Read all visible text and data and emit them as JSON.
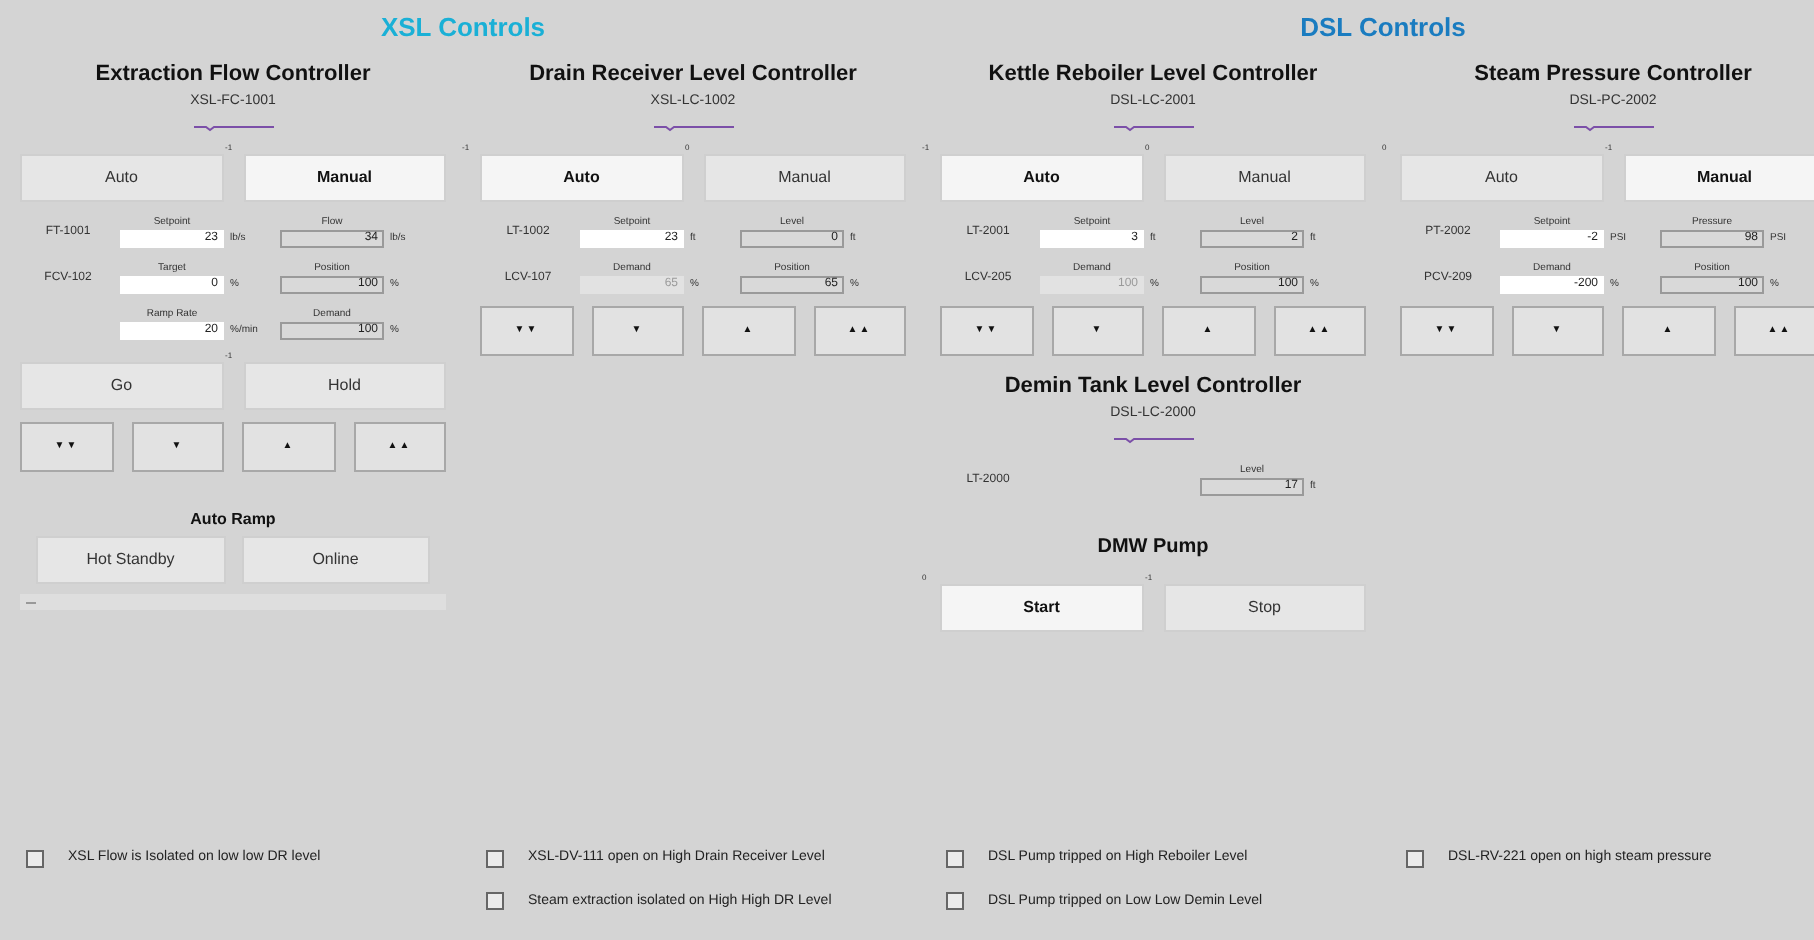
{
  "sections": [
    {
      "title": "XSL Controls",
      "color": "#1ab0d6",
      "columns": [
        [
          {
            "kind": "header",
            "title": "Extraction Flow Controller",
            "id": "XSL-FC-1001"
          },
          {
            "kind": "modes",
            "buttons": [
              {
                "label": "Auto",
                "selected": false
              },
              {
                "label": "Manual",
                "selected": true,
                "tag": "-1"
              }
            ]
          },
          {
            "kind": "fields",
            "tag": "FT-1001",
            "fields": [
              {
                "label": "Setpoint",
                "value": "23",
                "unit": "lb/s",
                "kind": "input"
              },
              {
                "label": "Flow",
                "value": "34",
                "unit": "lb/s",
                "kind": "readonly"
              }
            ]
          },
          {
            "kind": "fields",
            "tag": "FCV-102",
            "fields": [
              {
                "label": "Target",
                "value": "0",
                "unit": "%",
                "kind": "input"
              },
              {
                "label": "Position",
                "value": "100",
                "unit": "%",
                "kind": "readonly"
              }
            ]
          },
          {
            "kind": "fields",
            "fields": [
              {
                "label": "Ramp Rate",
                "value": "20",
                "unit": "%/min",
                "kind": "input"
              },
              {
                "label": "Demand",
                "value": "100",
                "unit": "%",
                "kind": "readonly"
              }
            ]
          },
          {
            "kind": "modes",
            "buttons": [
              {
                "label": "Go",
                "selected": false
              },
              {
                "label": "Hold",
                "selected": false,
                "tag": "-1"
              }
            ]
          },
          {
            "kind": "arrows",
            "buttons": [
              "▼▼",
              "▼",
              "▲",
              "▲▲"
            ]
          },
          {
            "kind": "subtitle",
            "text": "Auto Ramp"
          },
          {
            "kind": "buttons",
            "buttons": [
              "Hot Standby",
              "Online"
            ]
          },
          {
            "kind": "strip"
          }
        ],
        [
          {
            "kind": "header",
            "title": "Drain Receiver Level Controller",
            "id": "XSL-LC-1002"
          },
          {
            "kind": "modes",
            "buttons": [
              {
                "label": "Auto",
                "selected": true,
                "tag": "-1"
              },
              {
                "label": "Manual",
                "selected": false,
                "tag": "0"
              }
            ]
          },
          {
            "kind": "fields",
            "tag": "LT-1002",
            "fields": [
              {
                "label": "Setpoint",
                "value": "23",
                "unit": "ft",
                "kind": "input"
              },
              {
                "label": "Level",
                "value": "0",
                "unit": "ft",
                "kind": "readonly"
              }
            ]
          },
          {
            "kind": "fields",
            "tag": "LCV-107",
            "fields": [
              {
                "label": "Demand",
                "value": "65",
                "unit": "%",
                "kind": "disabled"
              },
              {
                "label": "Position",
                "value": "65",
                "unit": "%",
                "kind": "readonly"
              }
            ]
          },
          {
            "kind": "arrows",
            "buttons": [
              "▼▼",
              "▼",
              "▲",
              "▲▲"
            ]
          }
        ]
      ]
    },
    {
      "title": "DSL Controls",
      "color": "#1a7cc0",
      "columns": [
        [
          {
            "kind": "header",
            "title": "Kettle Reboiler Level Controller",
            "id": "DSL-LC-2001"
          },
          {
            "kind": "modes",
            "buttons": [
              {
                "label": "Auto",
                "selected": true,
                "tag": "-1"
              },
              {
                "label": "Manual",
                "selected": false,
                "tag": "0"
              }
            ]
          },
          {
            "kind": "fields",
            "tag": "LT-2001",
            "fields": [
              {
                "label": "Setpoint",
                "value": "3",
                "unit": "ft",
                "kind": "input"
              },
              {
                "label": "Level",
                "value": "2",
                "unit": "ft",
                "kind": "readonly"
              }
            ]
          },
          {
            "kind": "fields",
            "tag": "LCV-205",
            "fields": [
              {
                "label": "Demand",
                "value": "100",
                "unit": "%",
                "kind": "disabled"
              },
              {
                "label": "Position",
                "value": "100",
                "unit": "%",
                "kind": "readonly"
              }
            ]
          },
          {
            "kind": "arrows",
            "buttons": [
              "▼▼",
              "▼",
              "▲",
              "▲▲"
            ]
          },
          {
            "kind": "header",
            "title": "Demin Tank Level Controller",
            "id": "DSL-LC-2000"
          },
          {
            "kind": "fields",
            "tag": "LT-2000",
            "fields": [
              {
                "label": "Level",
                "value": "17",
                "unit": "ft",
                "kind": "readonly"
              }
            ]
          },
          {
            "kind": "subtitle",
            "text": "DMW Pump"
          },
          {
            "kind": "modes",
            "buttons": [
              {
                "label": "Start",
                "selected": true,
                "tag": "0"
              },
              {
                "label": "Stop",
                "selected": false,
                "tag": "-1"
              }
            ]
          }
        ],
        [
          {
            "kind": "header",
            "title": "Steam Pressure Controller",
            "id": "DSL-PC-2002"
          },
          {
            "kind": "modes",
            "buttons": [
              {
                "label": "Auto",
                "selected": false,
                "tag": "0"
              },
              {
                "label": "Manual",
                "selected": true,
                "tag": "-1"
              }
            ]
          },
          {
            "kind": "fields",
            "tag": "PT-2002",
            "fields": [
              {
                "label": "Setpoint",
                "value": "-2",
                "unit": "PSI",
                "kind": "input"
              },
              {
                "label": "Pressure",
                "value": "98",
                "unit": "PSI",
                "kind": "readonly"
              }
            ]
          },
          {
            "kind": "fields",
            "tag": "PCV-209",
            "fields": [
              {
                "label": "Demand",
                "value": "-200",
                "unit": "%",
                "kind": "input"
              },
              {
                "label": "Position",
                "value": "100",
                "unit": "%",
                "kind": "readonly"
              }
            ]
          },
          {
            "kind": "arrows",
            "buttons": [
              "▼▼",
              "▼",
              "▲",
              "▲▲"
            ]
          }
        ]
      ]
    }
  ],
  "alarm_columns": [
    [
      {
        "label": "XSL Flow is Isolated on low low DR level",
        "checked": false
      }
    ],
    [
      {
        "label": "XSL-DV-111 open on High Drain Receiver Level",
        "checked": false
      },
      {
        "label": "Steam extraction isolated on High High DR Level",
        "checked": false
      }
    ],
    [
      {
        "label": "DSL Pump tripped on High Reboiler Level",
        "checked": false
      },
      {
        "label": "DSL Pump tripped on Low Low Demin Level",
        "checked": false
      }
    ],
    [
      {
        "label": "DSL-RV-221 open on high steam pressure",
        "checked": false
      }
    ]
  ]
}
